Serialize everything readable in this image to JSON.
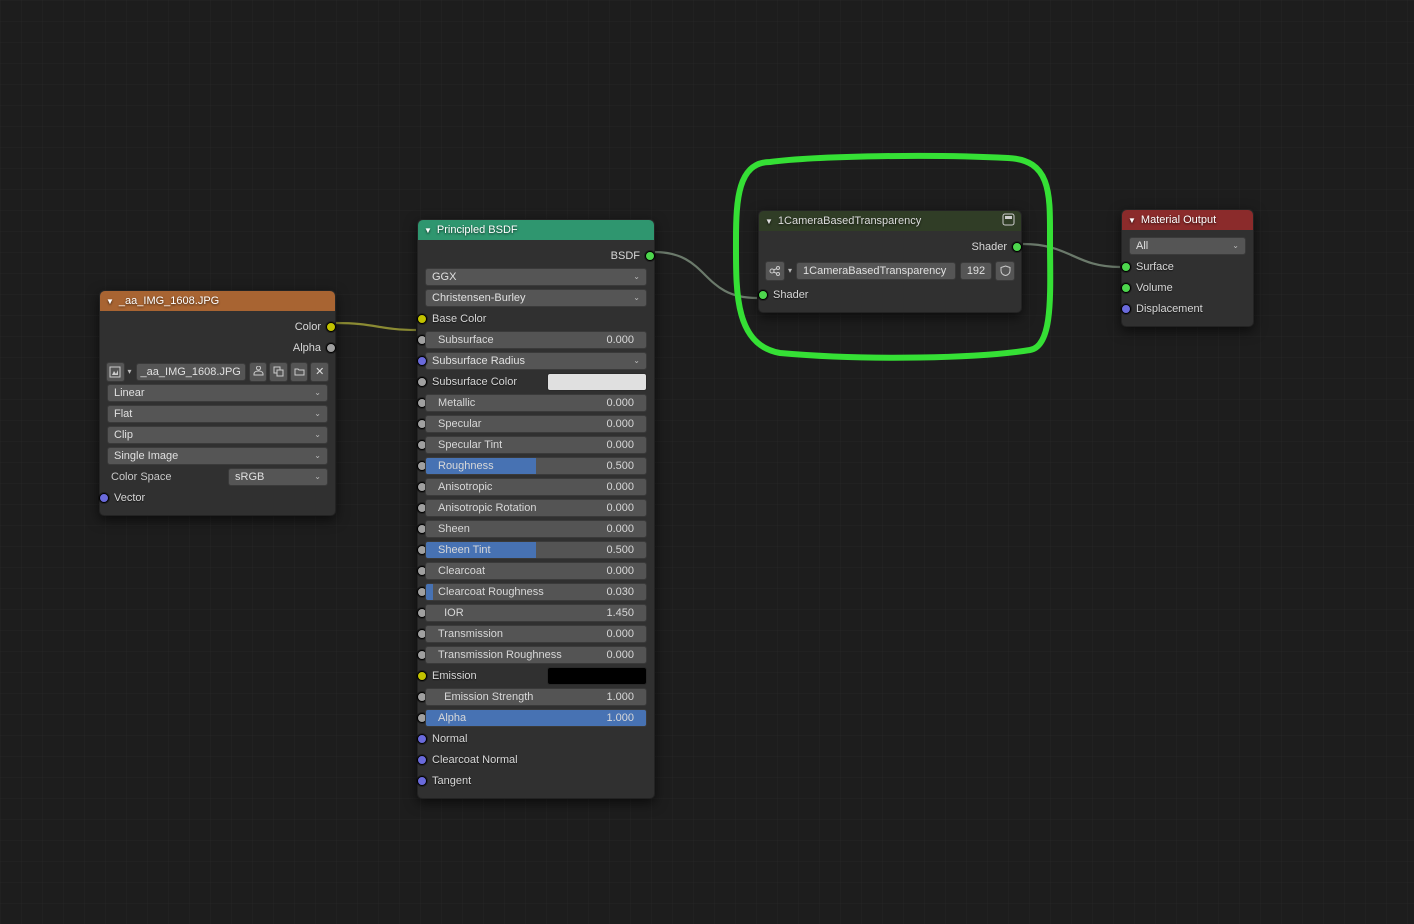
{
  "image_node": {
    "title": "_aa_IMG_1608.JPG",
    "color_out": "Color",
    "alpha_out": "Alpha",
    "image_field": "_aa_IMG_1608.JPG",
    "interpolation": "Linear",
    "projection": "Flat",
    "extension": "Clip",
    "source": "Single Image",
    "colorspace_label": "Color Space",
    "colorspace": "sRGB",
    "vector_in": "Vector"
  },
  "bsdf": {
    "title": "Principled BSDF",
    "bsdf_out": "BSDF",
    "distribution": "GGX",
    "subsurface_method": "Christensen-Burley",
    "inputs": [
      {
        "name": "Base Color",
        "type": "color"
      },
      {
        "name": "Subsurface",
        "type": "slider",
        "value": "0.000",
        "pct": 0
      },
      {
        "name": "Subsurface Radius",
        "type": "blue_drop"
      },
      {
        "name": "Subsurface Color",
        "type": "swatch",
        "color": "#e0e0e0"
      },
      {
        "name": "Metallic",
        "type": "slider",
        "value": "0.000",
        "pct": 0
      },
      {
        "name": "Specular",
        "type": "slider",
        "value": "0.000",
        "pct": 0
      },
      {
        "name": "Specular Tint",
        "type": "slider",
        "value": "0.000",
        "pct": 0
      },
      {
        "name": "Roughness",
        "type": "slider",
        "value": "0.500",
        "pct": 50
      },
      {
        "name": "Anisotropic",
        "type": "slider",
        "value": "0.000",
        "pct": 0
      },
      {
        "name": "Anisotropic Rotation",
        "type": "slider",
        "value": "0.000",
        "pct": 0
      },
      {
        "name": "Sheen",
        "type": "slider",
        "value": "0.000",
        "pct": 0
      },
      {
        "name": "Sheen Tint",
        "type": "slider",
        "value": "0.500",
        "pct": 50
      },
      {
        "name": "Clearcoat",
        "type": "slider",
        "value": "0.000",
        "pct": 0
      },
      {
        "name": "Clearcoat Roughness",
        "type": "slider",
        "value": "0.030",
        "pct": 3
      },
      {
        "name": "IOR",
        "type": "slider",
        "value": "1.450",
        "pct": 0,
        "indent": true
      },
      {
        "name": "Transmission",
        "type": "slider",
        "value": "0.000",
        "pct": 0
      },
      {
        "name": "Transmission Roughness",
        "type": "slider",
        "value": "0.000",
        "pct": 0
      },
      {
        "name": "Emission",
        "type": "swatch",
        "color": "#000000",
        "socket": "color"
      },
      {
        "name": "Emission Strength",
        "type": "slider",
        "value": "1.000",
        "pct": 0,
        "indent": true
      },
      {
        "name": "Alpha",
        "type": "slider",
        "value": "1.000",
        "pct": 100
      },
      {
        "name": "Normal",
        "type": "label",
        "socket": "blue"
      },
      {
        "name": "Clearcoat Normal",
        "type": "label",
        "socket": "blue"
      },
      {
        "name": "Tangent",
        "type": "label",
        "socket": "blue"
      }
    ]
  },
  "group": {
    "title": "1CameraBasedTransparency",
    "shader_out": "Shader",
    "node_tree": "1CameraBasedTransparency",
    "users": "192",
    "shader_in": "Shader"
  },
  "output": {
    "title": "Material Output",
    "target": "All",
    "surface": "Surface",
    "volume": "Volume",
    "displacement": "Displacement"
  }
}
